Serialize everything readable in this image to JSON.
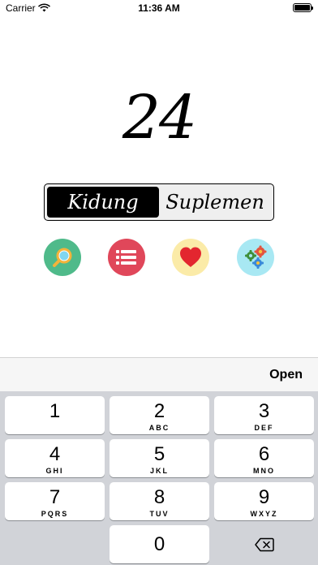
{
  "status_bar": {
    "carrier": "Carrier",
    "time": "11:36 AM",
    "wifi_icon": "wifi-icon",
    "battery_icon": "battery-icon"
  },
  "hymn_number": "24",
  "segments": [
    {
      "label": "Kidung",
      "selected": true
    },
    {
      "label": "Suplemen",
      "selected": false
    }
  ],
  "action_icons": [
    {
      "name": "search-icon",
      "color": "#4fba8a"
    },
    {
      "name": "list-icon",
      "color": "#e0475a"
    },
    {
      "name": "heart-icon",
      "color": "#fbeba8"
    },
    {
      "name": "settings-gears-icon",
      "color": "#a8e8f3"
    }
  ],
  "accessory": {
    "open_label": "Open"
  },
  "keypad": {
    "keys": [
      {
        "digit": "1",
        "letters": ""
      },
      {
        "digit": "2",
        "letters": "ABC"
      },
      {
        "digit": "3",
        "letters": "DEF"
      },
      {
        "digit": "4",
        "letters": "GHI"
      },
      {
        "digit": "5",
        "letters": "JKL"
      },
      {
        "digit": "6",
        "letters": "MNO"
      },
      {
        "digit": "7",
        "letters": "PQRS"
      },
      {
        "digit": "8",
        "letters": "TUV"
      },
      {
        "digit": "9",
        "letters": "WXYZ"
      },
      {
        "digit": "0",
        "letters": ""
      }
    ],
    "delete_icon": "backspace-icon"
  },
  "colors": {
    "keyboard_bg": "#d1d3d8",
    "accessory_bg": "#f6f6f6",
    "segment_active": "#000000"
  }
}
